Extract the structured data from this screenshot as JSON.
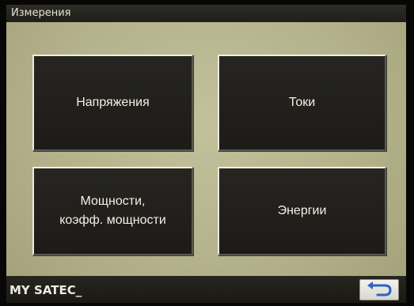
{
  "window": {
    "title": "Измерения"
  },
  "menu": {
    "voltages_label": "Напряжения",
    "currents_label": "Токи",
    "power_label_line1": "Мощности,",
    "power_label_line2": "коэфф. мощности",
    "energies_label": "Энергии"
  },
  "status_bar": {
    "device_name": "MY SATEC_",
    "back_icon": "return-arrow-icon"
  },
  "colors": {
    "screen_background": "#b8b691",
    "button_fill": "#211f1c",
    "button_text": "#f2f0e6",
    "bar_fill": "#1f1e1a",
    "back_arrow": "#2f63c5"
  }
}
